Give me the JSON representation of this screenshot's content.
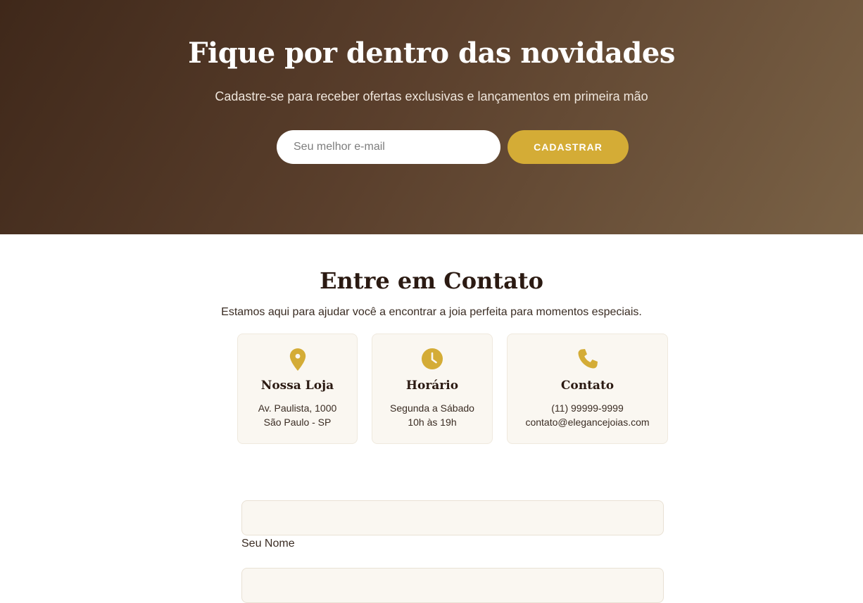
{
  "newsletter": {
    "title": "Fique por dentro das novidades",
    "subtitle": "Cadastre-se para receber ofertas exclusivas e lançamentos em primeira mão",
    "email_placeholder": "Seu melhor e-mail",
    "button_label": "CADASTRAR"
  },
  "contact": {
    "title": "Entre em Contato",
    "subtitle": "Estamos aqui para ajudar você a encontrar a joia perfeita para momentos especiais.",
    "cards": [
      {
        "icon": "map-pin-icon",
        "title": "Nossa Loja",
        "line1": "Av. Paulista, 1000",
        "line2": "São Paulo - SP"
      },
      {
        "icon": "clock-icon",
        "title": "Horário",
        "line1": "Segunda a Sábado",
        "line2": "10h às 19h"
      },
      {
        "icon": "phone-icon",
        "title": "Contato",
        "line1": "(11) 99999-9999",
        "line2": "contato@elegancejoias.com"
      }
    ]
  },
  "form": {
    "name_label": "Seu Nome",
    "name_value": "",
    "second_value": ""
  },
  "colors": {
    "accent": "#d4ac36",
    "hero_start": "#3f281a",
    "hero_end": "#7a6246",
    "card_bg": "#faf7f1"
  }
}
